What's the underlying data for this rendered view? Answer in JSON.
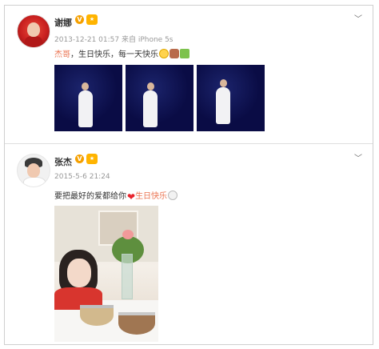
{
  "posts": [
    {
      "username": "谢娜",
      "vip_label": "V",
      "meta": "2013-12-21 01:57 来自 iPhone 5s",
      "text_highlight": "杰哥",
      "text_main": "，生日快乐，每一天快乐",
      "emojis": [
        "laughing-emoji",
        "cake-emoji",
        "gift-emoji"
      ]
    },
    {
      "username": "张杰",
      "vip_label": "V",
      "meta": "2015-5-6 21:24",
      "text_before": "要把最好的爱都给你",
      "text_highlight": "生日快乐",
      "emojis": [
        "heart-emoji",
        "cat-emoji"
      ]
    }
  ],
  "icons": {
    "more": "chevron-down-icon",
    "verified": "v-badge-icon"
  },
  "colors": {
    "highlight": "#eb7350",
    "badge": "#f5a000",
    "meta_text": "#999999",
    "concert_bg": "#0a0c45"
  }
}
